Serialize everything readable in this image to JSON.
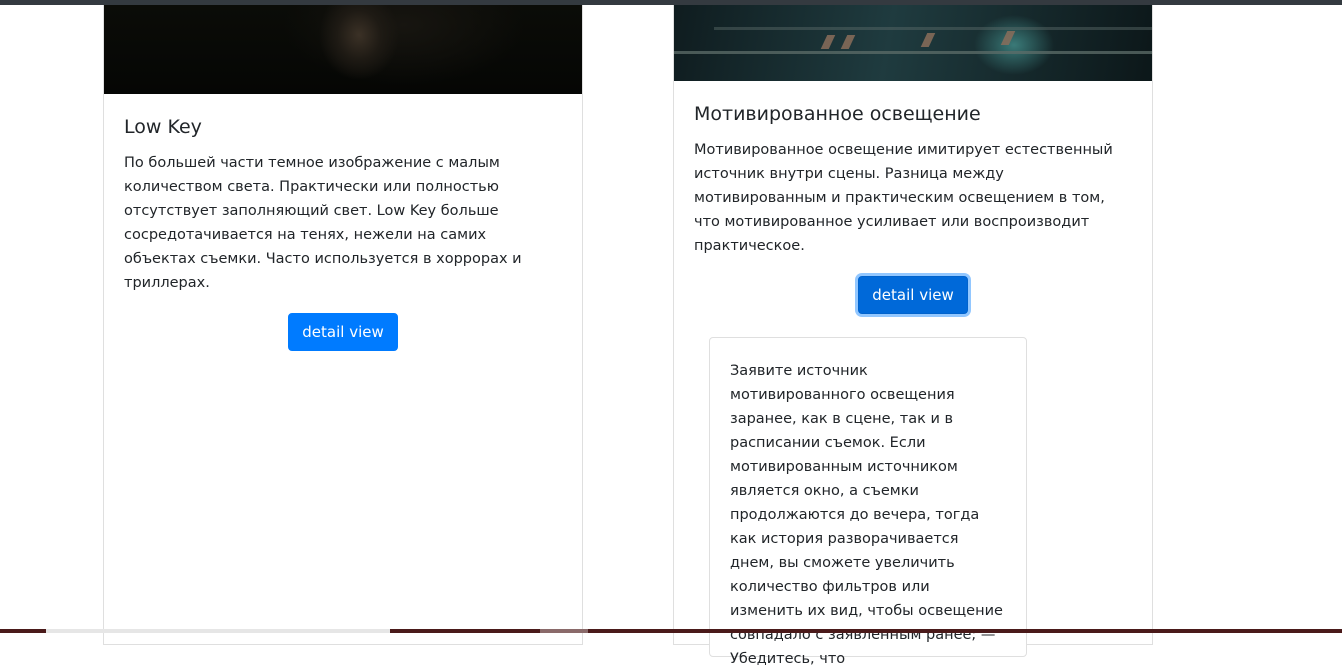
{
  "cards": [
    {
      "title": "Low Key",
      "text": "По большей части темное изображение с малым количеством света. Практически или полностью отсутствует заполняющий свет. Low Key больше сосредотачивается на тенях, нежели на самих объектах съемки. Часто используется в хоррорах и триллерах.",
      "button_label": "detail view",
      "image_icon": "dark-scene-photo"
    },
    {
      "title": "Мотивированное освещение",
      "text": "Мотивированное освещение имитирует естественный источник внутри сцены. Разница между мотивированным и практическим освещением в том, что мотивированное усиливает или воспроизводит практическое.",
      "button_label": "detail view",
      "image_icon": "film-rails-photo",
      "detail_text": "Заявите источник мотивированного освещения заранее, как в сцене, так и в расписании съемок. Если мотивированным источником является окно, а съемки продолжаются до вечера, тогда как история разворачивается днем, вы сможете увеличить количество фильтров или изменить их вид, чтобы освещение совпадало с заявленным ранее; — Убедитесь, что"
    }
  ],
  "colors": {
    "primary": "#007bff",
    "primary_focused": "#0069d9",
    "top_bar": "#343a40"
  }
}
